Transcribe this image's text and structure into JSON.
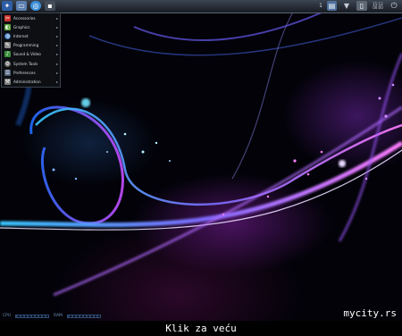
{
  "topbar": {
    "workspace": "1",
    "clock_time": "15:12",
    "clock_date": "00:00"
  },
  "menu": {
    "items": [
      {
        "label": "Accessories",
        "icon": "accessories-icon",
        "color": "#c9312b"
      },
      {
        "label": "Graphics",
        "icon": "graphics-icon",
        "color": "#5aa33a"
      },
      {
        "label": "Internet",
        "icon": "internet-icon",
        "color": "#2f6fb6"
      },
      {
        "label": "Programming",
        "icon": "programming-icon",
        "color": "#8a8a8a"
      },
      {
        "label": "Sound & Video",
        "icon": "sound-video-icon",
        "color": "#3b8f3b"
      },
      {
        "label": "System Tools",
        "icon": "system-tools-icon",
        "color": "#6a6a6a"
      },
      {
        "label": "Preferences",
        "icon": "preferences-icon",
        "color": "#4b5f7a"
      },
      {
        "label": "Administration",
        "icon": "administration-icon",
        "color": "#7a7a7a"
      }
    ]
  },
  "bottombar": {
    "cpu_label": "CPU",
    "ram_label": "RAM"
  },
  "watermark": "mycity.rs",
  "caption": "Klik za veću"
}
